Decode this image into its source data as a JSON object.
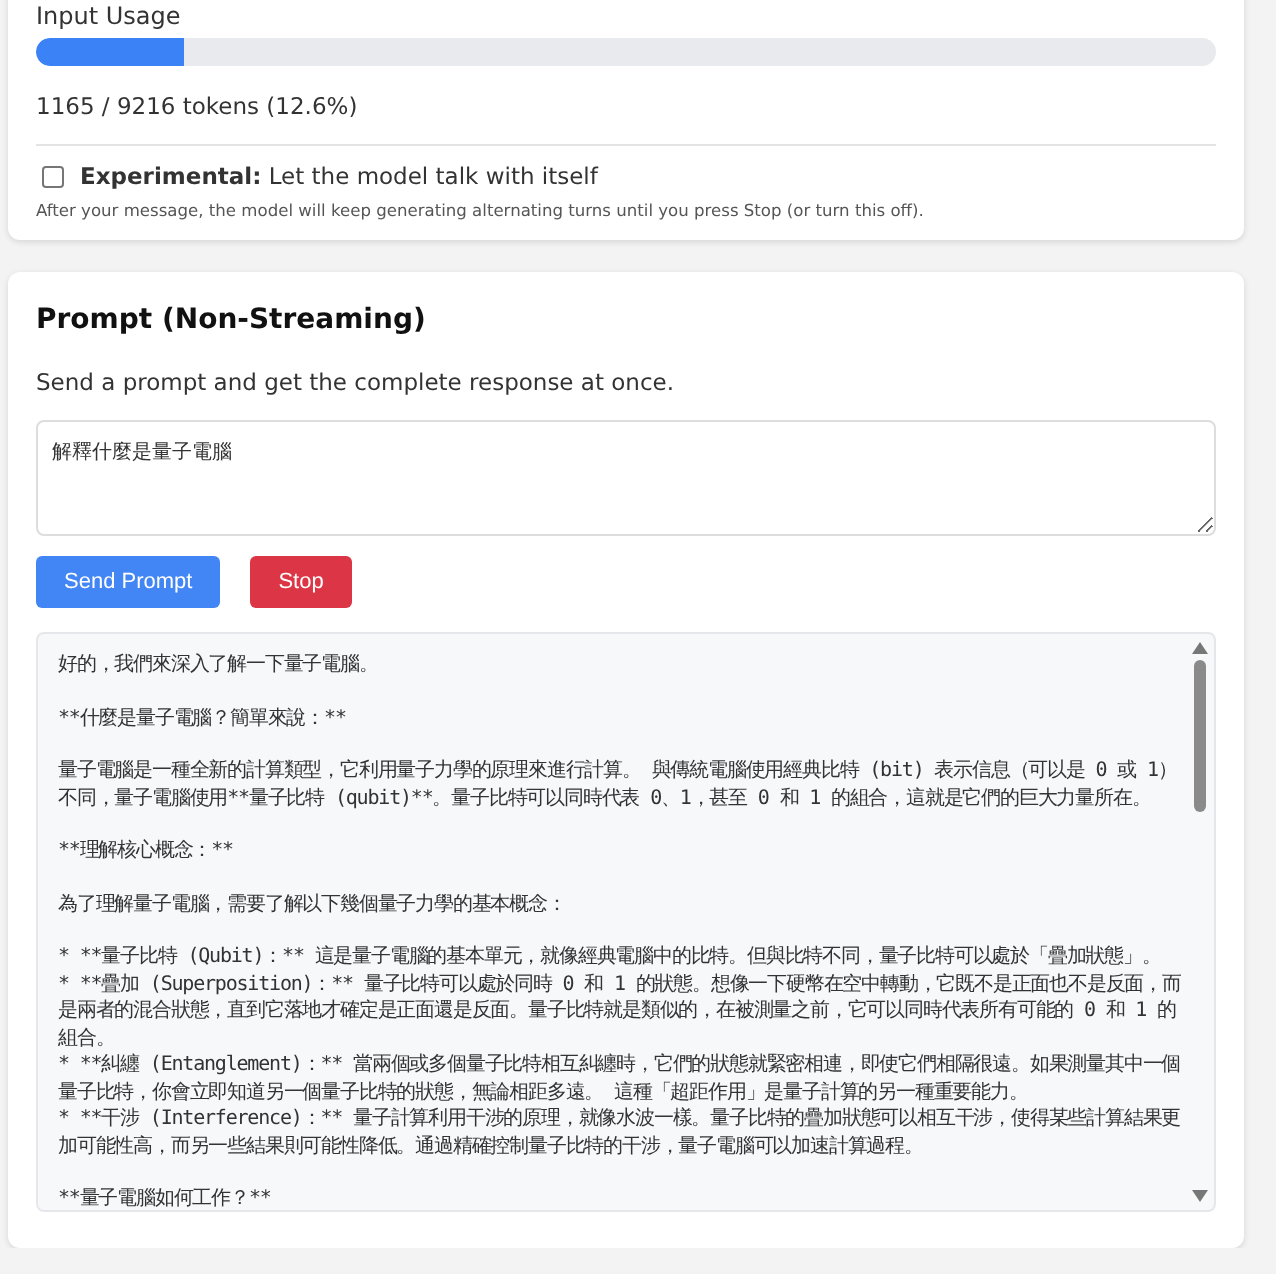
{
  "usage": {
    "title": "Input Usage",
    "level": 0.126,
    "reading": "1165 / 9216 tokens (12.6%)"
  },
  "experimental": {
    "checked": false,
    "label_bold": "Experimental:",
    "label": "Let the model talk with itself",
    "hint": "After your message, the model will keep generating alternating turns until you press Stop (or turn this off)."
  },
  "prompt": {
    "title": "Prompt (Non-Streaming)",
    "description": "Send a prompt and get the complete response at once.",
    "value": "解釋什麼是量子電腦",
    "buttons": [
      {
        "label": "Send Prompt",
        "kind": "primary"
      },
      {
        "label": "Stop",
        "kind": "danger"
      }
    ]
  },
  "response": [
    [
      "好的，我們來深入了解一下量子電腦。"
    ],
    [
      "**什麼是量子電腦？簡單來說：**"
    ],
    [
      "量子電腦是一種全新的計算類型，它利用量子力學的原理來進行計算。 與傳統電腦使用經典比特 (bit) 表示信息（可以是 0 或 1）不同，量子電腦使用**量子比特 (qubit)**。量子比特可以同時代表 0、1，甚至 0 和 1 的組合，這就是它們的巨大力量所在。"
    ],
    [
      "**理解核心概念：**"
    ],
    [
      "為了理解量子電腦，需要了解以下幾個量子力學的基本概念："
    ],
    [
      "* **量子比特 (Qubit)：**  這是量子電腦的基本單元，就像經典電腦中的比特。但與比特不同，量子比特可以處於「疊加狀態」。",
      "* **疊加 (Superposition)：** 量子比特可以處於同時 0 和 1 的狀態。想像一下硬幣在空中轉動，它既不是正面也不是反面，而是兩者的混合狀態，直到它落地才確定是正面還是反面。量子比特就是類似的，在被測量之前，它可以同時代表所有可能的 0 和 1 的組合。",
      "* **糾纏 (Entanglement)：** 當兩個或多個量子比特相互糾纏時，它們的狀態就緊密相連，即使它們相隔很遠。如果測量其中一個量子比特，你會立即知道另一個量子比特的狀態，無論相距多遠。  這種「超距作用」是量子計算的另一種重要能力。",
      "* **干涉 (Interference)：**  量子計算利用干涉的原理，就像水波一樣。量子比特的疊加狀態可以相互干涉，使得某些計算結果更加可能性高，而另一些結果則可能性降低。通過精確控制量子比特的干涉，量子電腦可以加速計算過程。"
    ],
    [
      "**量子電腦如何工作？**"
    ]
  ]
}
